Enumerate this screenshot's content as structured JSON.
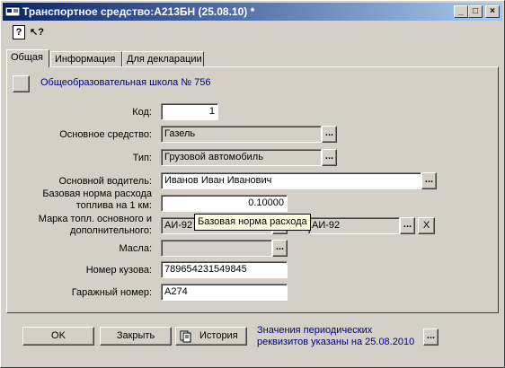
{
  "window": {
    "title": "Транспортное средство:А213БН (25.08.10) *",
    "controls": {
      "minimize": "_",
      "maximize": "□",
      "close": "×"
    }
  },
  "toolbar": {
    "help_icon": "?",
    "whatsthis_icon": "↖?"
  },
  "tabs": [
    {
      "label": "Общая",
      "active": true
    },
    {
      "label": "Информация",
      "active": false
    },
    {
      "label": "Для декларации",
      "active": false
    }
  ],
  "form": {
    "owner_link": "Общеобразовательная школа № 756",
    "code_label": "Код:",
    "code_value": "1",
    "asset_label": "Основное средство:",
    "asset_value": "Газель",
    "type_label": "Тип:",
    "type_value": "Грузовой автомобиль",
    "driver_label": "Основной водитель:",
    "driver_value": "Иванов Иван Иванович",
    "norm_label_1": "Базовая норма расхода",
    "norm_label_2": "топлива на 1 км:",
    "norm_value": "0.10000",
    "fuel_label_1": "Марка топл. основного  и",
    "fuel_label_2": "дополнительного:",
    "fuel_main": "АИ-92",
    "fuel_extra": "АИ-92",
    "oil_label": "Масла:",
    "oil_value": "",
    "body_label": "Номер кузова:",
    "body_value": "789654231549845",
    "garage_label": "Гаражный номер:",
    "garage_value": "А274",
    "dots": "...",
    "clear": "X"
  },
  "tooltip": "Базовая норма расхода",
  "footer": {
    "ok": "OK",
    "close": "Закрыть",
    "history": "История",
    "note_1": "Значения периодических",
    "note_2": "реквизитов указаны на 25.08.2010",
    "dots": "..."
  },
  "colors": {
    "title_start": "#0a246a",
    "title_end": "#a6caf0",
    "face": "#d4d0c8",
    "link": "#000080",
    "tooltip": "#ffffe1"
  }
}
